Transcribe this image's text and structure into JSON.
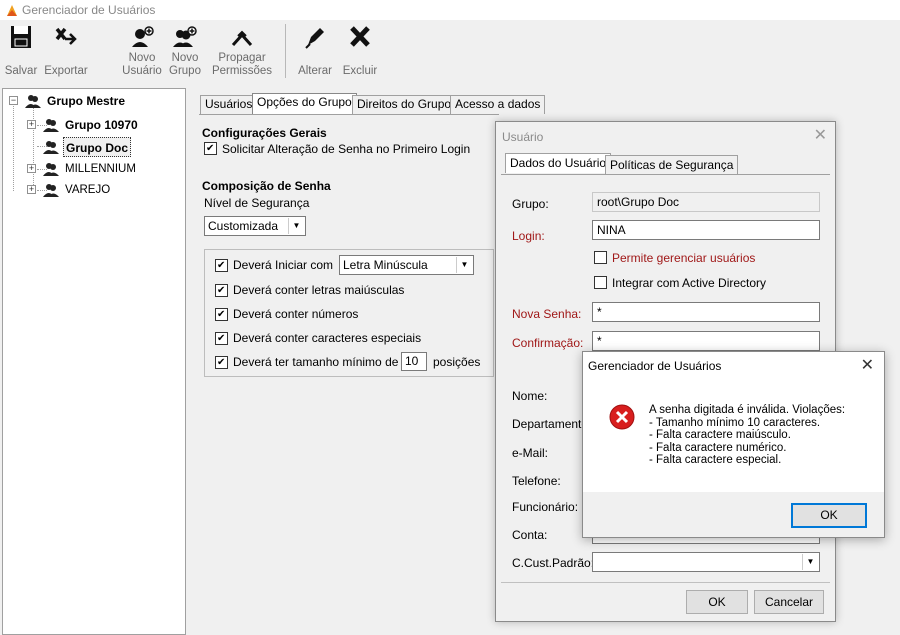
{
  "window": {
    "title": "Gerenciador de Usuários"
  },
  "toolbar": {
    "buttons": [
      {
        "label": "Salvar",
        "icon": "save-icon"
      },
      {
        "label": "Exportar",
        "icon": "export-icon"
      },
      {
        "label": "Novo\nUsuário",
        "icon": "new-user-icon"
      },
      {
        "label": "Novo\nGrupo",
        "icon": "new-group-icon"
      },
      {
        "label": "Propagar\nPermissões",
        "icon": "propagate-icon"
      },
      {
        "label": "Alterar",
        "icon": "edit-icon"
      },
      {
        "label": "Excluir",
        "icon": "delete-icon"
      }
    ]
  },
  "tree": {
    "root": "Grupo Mestre",
    "children": [
      "Grupo 10970",
      "Grupo Doc",
      "MILLENNIUM",
      "VAREJO"
    ],
    "selected": "Grupo Doc"
  },
  "tabs": [
    "Usuários",
    "Opções do Grupo",
    "Direitos do Grupo",
    "Acesso a dados"
  ],
  "options": {
    "general_heading": "Configurações Gerais",
    "require_change": "Solicitar Alteração de Senha no Primeiro Login",
    "composition_heading": "Composição de Senha",
    "security_level_label": "Nível de Segurança",
    "security_level_value": "Customizada",
    "start_with_label": "Deverá Iniciar com",
    "start_with_value": "Letra Minúscula",
    "uppercase": "Deverá conter letras maiúsculas",
    "numbers": "Deverá conter números",
    "special": "Deverá conter caracteres especiais",
    "min_length_label": "Deverá ter tamanho mínimo de",
    "min_length_value": "10",
    "min_length_suffix": "posições"
  },
  "user_dialog": {
    "title": "Usuário",
    "tabs": [
      "Dados do Usuário",
      "Políticas de Segurança"
    ],
    "group_label": "Grupo:",
    "group_value": "root\\Grupo Doc",
    "login_label": "Login:",
    "login_value": "NINA",
    "manage_users": "Permite gerenciar usuários",
    "active_directory": "Integrar com Active Directory",
    "new_password_label": "Nova Senha:",
    "new_password_value": "*",
    "confirm_label": "Confirmação:",
    "confirm_value": "*",
    "name_label": "Nome:",
    "department_label": "Departamento",
    "email_label": "e-Mail:",
    "phone_label": "Telefone:",
    "employee_label": "Funcionário:",
    "account_label": "Conta:",
    "cost_center_label": "C.Cust.Padrão:",
    "ok_label": "OK",
    "cancel_label": "Cancelar"
  },
  "message_box": {
    "title": "Gerenciador de Usuários",
    "text": "A senha digitada é inválida. Violações:\n- Tamanho mínimo 10 caracteres.\n- Falta caractere maiúsculo.\n- Falta caractere numérico.\n- Falta caractere especial.",
    "ok_label": "OK",
    "icon": "error-icon"
  },
  "colors": {
    "required_label": "#a01818",
    "error": "#d81e1e",
    "focus": "#0078d7"
  }
}
